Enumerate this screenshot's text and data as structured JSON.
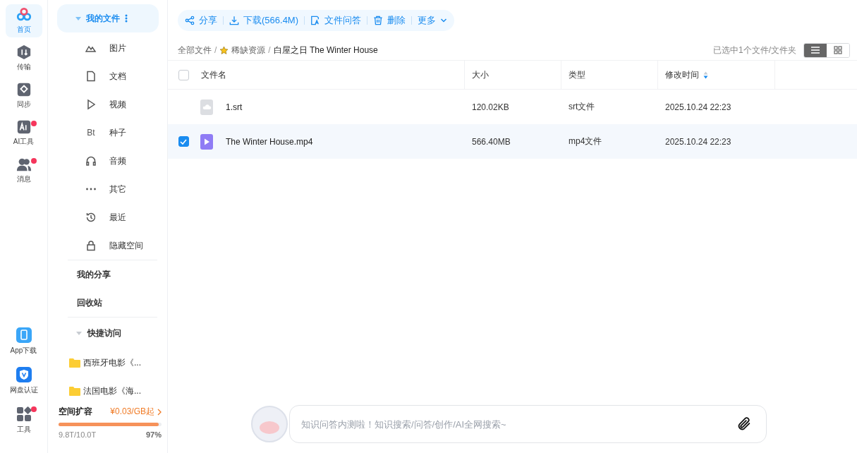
{
  "rail": {
    "items": [
      {
        "label": "首页",
        "kind": "home",
        "selected": true,
        "badge": false
      },
      {
        "label": "传输",
        "kind": "transfer",
        "selected": false,
        "badge": false
      },
      {
        "label": "同步",
        "kind": "sync",
        "selected": false,
        "badge": false
      },
      {
        "label": "AI工具",
        "kind": "ai",
        "selected": false,
        "badge": true
      },
      {
        "label": "消息",
        "kind": "message",
        "selected": false,
        "badge": true
      }
    ],
    "bottom_items": [
      {
        "label": "App下载",
        "kind": "phone",
        "badge": false
      },
      {
        "label": "网盘认证",
        "kind": "verify",
        "badge": false
      },
      {
        "label": "工具",
        "kind": "tools",
        "badge": true
      }
    ]
  },
  "sidebar": {
    "header": {
      "label": "我的文件",
      "expanded": true
    },
    "categories": [
      {
        "label": "图片",
        "kind": "image"
      },
      {
        "label": "文档",
        "kind": "doc"
      },
      {
        "label": "视频",
        "kind": "video"
      },
      {
        "label": "种子",
        "kind": "bt",
        "glyph": "Bt"
      },
      {
        "label": "音频",
        "kind": "audio"
      },
      {
        "label": "其它",
        "kind": "other"
      },
      {
        "label": "最近",
        "kind": "recent"
      },
      {
        "label": "隐藏空间",
        "kind": "lock"
      }
    ],
    "links": [
      "我的分享",
      "回收站"
    ],
    "quick_access": {
      "label": "快捷访问",
      "expanded": true,
      "folders": [
        "西班牙电影《...",
        "法国电影《海..."
      ]
    },
    "storage": {
      "label": "空间扩容",
      "offer": "¥0.03/GB起",
      "used": "9.8T/10.0T",
      "percent": "97%",
      "level": 0.97
    }
  },
  "toolbar": [
    {
      "label": "分享",
      "kind": "share"
    },
    {
      "label": "下载(566.4M)",
      "kind": "download"
    },
    {
      "label": "文件问答",
      "kind": "ask"
    },
    {
      "label": "删除",
      "kind": "delete"
    },
    {
      "label": "更多",
      "kind": "more"
    }
  ],
  "breadcrumb": [
    {
      "label": "全部文件",
      "starred": false
    },
    {
      "label": "稀缺资源",
      "starred": true
    },
    {
      "label": "白屋之日 The Winter House",
      "starred": false
    }
  ],
  "breadcrumb_separator": "/",
  "selection_info": "已选中1个文件/文件夹",
  "view_modes": [
    {
      "kind": "list",
      "selected": true
    },
    {
      "kind": "grid",
      "selected": false
    }
  ],
  "table": {
    "all_checked": false,
    "columns": [
      {
        "label": "文件名",
        "sorted": false
      },
      {
        "label": "大小",
        "sorted": false
      },
      {
        "label": "类型",
        "sorted": false
      },
      {
        "label": "修改时间",
        "sorted": true
      }
    ],
    "rows": [
      {
        "name": "1.srt",
        "kind": "subtitle",
        "size": "120.02KB",
        "type": "srt文件",
        "modified": "2025.10.24 22:23",
        "selected": false
      },
      {
        "name": "The Winter House.mp4",
        "kind": "video",
        "size": "566.40MB",
        "type": "mp4文件",
        "modified": "2025.10.24 22:23",
        "selected": true
      }
    ]
  },
  "assistant": {
    "placeholder": "知识问答内测啦！知识搜索/问答/创作/AI全网搜索~"
  }
}
